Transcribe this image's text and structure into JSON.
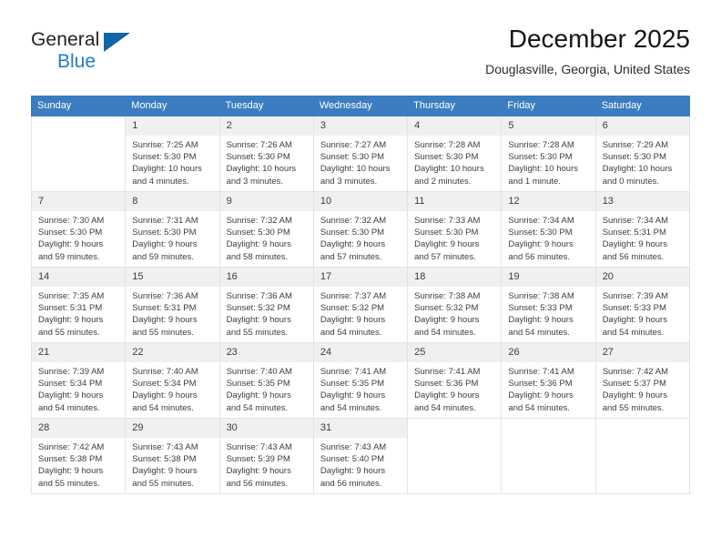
{
  "brand": {
    "name_part1": "General",
    "name_part2": "Blue",
    "triangle_icon": "triangle-logo-icon",
    "accent_color": "#1165ab",
    "blue_text_color": "#1e7bc4"
  },
  "header": {
    "title": "December 2025",
    "subtitle": "Douglasville, Georgia, United States"
  },
  "calendar": {
    "header_background": "#3b7dc0",
    "daynum_background": "#f0f0f0",
    "weekdays": [
      "Sunday",
      "Monday",
      "Tuesday",
      "Wednesday",
      "Thursday",
      "Friday",
      "Saturday"
    ],
    "labels": {
      "sunrise": "Sunrise:",
      "sunset": "Sunset:",
      "daylight": "Daylight:"
    },
    "weeks": [
      [
        {
          "day": "",
          "sunrise": "",
          "sunset": "",
          "daylight_line1": "",
          "daylight_line2": ""
        },
        {
          "day": "1",
          "sunrise": "Sunrise: 7:25 AM",
          "sunset": "Sunset: 5:30 PM",
          "daylight_line1": "Daylight: 10 hours",
          "daylight_line2": "and 4 minutes."
        },
        {
          "day": "2",
          "sunrise": "Sunrise: 7:26 AM",
          "sunset": "Sunset: 5:30 PM",
          "daylight_line1": "Daylight: 10 hours",
          "daylight_line2": "and 3 minutes."
        },
        {
          "day": "3",
          "sunrise": "Sunrise: 7:27 AM",
          "sunset": "Sunset: 5:30 PM",
          "daylight_line1": "Daylight: 10 hours",
          "daylight_line2": "and 3 minutes."
        },
        {
          "day": "4",
          "sunrise": "Sunrise: 7:28 AM",
          "sunset": "Sunset: 5:30 PM",
          "daylight_line1": "Daylight: 10 hours",
          "daylight_line2": "and 2 minutes."
        },
        {
          "day": "5",
          "sunrise": "Sunrise: 7:28 AM",
          "sunset": "Sunset: 5:30 PM",
          "daylight_line1": "Daylight: 10 hours",
          "daylight_line2": "and 1 minute."
        },
        {
          "day": "6",
          "sunrise": "Sunrise: 7:29 AM",
          "sunset": "Sunset: 5:30 PM",
          "daylight_line1": "Daylight: 10 hours",
          "daylight_line2": "and 0 minutes."
        }
      ],
      [
        {
          "day": "7",
          "sunrise": "Sunrise: 7:30 AM",
          "sunset": "Sunset: 5:30 PM",
          "daylight_line1": "Daylight: 9 hours",
          "daylight_line2": "and 59 minutes."
        },
        {
          "day": "8",
          "sunrise": "Sunrise: 7:31 AM",
          "sunset": "Sunset: 5:30 PM",
          "daylight_line1": "Daylight: 9 hours",
          "daylight_line2": "and 59 minutes."
        },
        {
          "day": "9",
          "sunrise": "Sunrise: 7:32 AM",
          "sunset": "Sunset: 5:30 PM",
          "daylight_line1": "Daylight: 9 hours",
          "daylight_line2": "and 58 minutes."
        },
        {
          "day": "10",
          "sunrise": "Sunrise: 7:32 AM",
          "sunset": "Sunset: 5:30 PM",
          "daylight_line1": "Daylight: 9 hours",
          "daylight_line2": "and 57 minutes."
        },
        {
          "day": "11",
          "sunrise": "Sunrise: 7:33 AM",
          "sunset": "Sunset: 5:30 PM",
          "daylight_line1": "Daylight: 9 hours",
          "daylight_line2": "and 57 minutes."
        },
        {
          "day": "12",
          "sunrise": "Sunrise: 7:34 AM",
          "sunset": "Sunset: 5:30 PM",
          "daylight_line1": "Daylight: 9 hours",
          "daylight_line2": "and 56 minutes."
        },
        {
          "day": "13",
          "sunrise": "Sunrise: 7:34 AM",
          "sunset": "Sunset: 5:31 PM",
          "daylight_line1": "Daylight: 9 hours",
          "daylight_line2": "and 56 minutes."
        }
      ],
      [
        {
          "day": "14",
          "sunrise": "Sunrise: 7:35 AM",
          "sunset": "Sunset: 5:31 PM",
          "daylight_line1": "Daylight: 9 hours",
          "daylight_line2": "and 55 minutes."
        },
        {
          "day": "15",
          "sunrise": "Sunrise: 7:36 AM",
          "sunset": "Sunset: 5:31 PM",
          "daylight_line1": "Daylight: 9 hours",
          "daylight_line2": "and 55 minutes."
        },
        {
          "day": "16",
          "sunrise": "Sunrise: 7:36 AM",
          "sunset": "Sunset: 5:32 PM",
          "daylight_line1": "Daylight: 9 hours",
          "daylight_line2": "and 55 minutes."
        },
        {
          "day": "17",
          "sunrise": "Sunrise: 7:37 AM",
          "sunset": "Sunset: 5:32 PM",
          "daylight_line1": "Daylight: 9 hours",
          "daylight_line2": "and 54 minutes."
        },
        {
          "day": "18",
          "sunrise": "Sunrise: 7:38 AM",
          "sunset": "Sunset: 5:32 PM",
          "daylight_line1": "Daylight: 9 hours",
          "daylight_line2": "and 54 minutes."
        },
        {
          "day": "19",
          "sunrise": "Sunrise: 7:38 AM",
          "sunset": "Sunset: 5:33 PM",
          "daylight_line1": "Daylight: 9 hours",
          "daylight_line2": "and 54 minutes."
        },
        {
          "day": "20",
          "sunrise": "Sunrise: 7:39 AM",
          "sunset": "Sunset: 5:33 PM",
          "daylight_line1": "Daylight: 9 hours",
          "daylight_line2": "and 54 minutes."
        }
      ],
      [
        {
          "day": "21",
          "sunrise": "Sunrise: 7:39 AM",
          "sunset": "Sunset: 5:34 PM",
          "daylight_line1": "Daylight: 9 hours",
          "daylight_line2": "and 54 minutes."
        },
        {
          "day": "22",
          "sunrise": "Sunrise: 7:40 AM",
          "sunset": "Sunset: 5:34 PM",
          "daylight_line1": "Daylight: 9 hours",
          "daylight_line2": "and 54 minutes."
        },
        {
          "day": "23",
          "sunrise": "Sunrise: 7:40 AM",
          "sunset": "Sunset: 5:35 PM",
          "daylight_line1": "Daylight: 9 hours",
          "daylight_line2": "and 54 minutes."
        },
        {
          "day": "24",
          "sunrise": "Sunrise: 7:41 AM",
          "sunset": "Sunset: 5:35 PM",
          "daylight_line1": "Daylight: 9 hours",
          "daylight_line2": "and 54 minutes."
        },
        {
          "day": "25",
          "sunrise": "Sunrise: 7:41 AM",
          "sunset": "Sunset: 5:36 PM",
          "daylight_line1": "Daylight: 9 hours",
          "daylight_line2": "and 54 minutes."
        },
        {
          "day": "26",
          "sunrise": "Sunrise: 7:41 AM",
          "sunset": "Sunset: 5:36 PM",
          "daylight_line1": "Daylight: 9 hours",
          "daylight_line2": "and 54 minutes."
        },
        {
          "day": "27",
          "sunrise": "Sunrise: 7:42 AM",
          "sunset": "Sunset: 5:37 PM",
          "daylight_line1": "Daylight: 9 hours",
          "daylight_line2": "and 55 minutes."
        }
      ],
      [
        {
          "day": "28",
          "sunrise": "Sunrise: 7:42 AM",
          "sunset": "Sunset: 5:38 PM",
          "daylight_line1": "Daylight: 9 hours",
          "daylight_line2": "and 55 minutes."
        },
        {
          "day": "29",
          "sunrise": "Sunrise: 7:43 AM",
          "sunset": "Sunset: 5:38 PM",
          "daylight_line1": "Daylight: 9 hours",
          "daylight_line2": "and 55 minutes."
        },
        {
          "day": "30",
          "sunrise": "Sunrise: 7:43 AM",
          "sunset": "Sunset: 5:39 PM",
          "daylight_line1": "Daylight: 9 hours",
          "daylight_line2": "and 56 minutes."
        },
        {
          "day": "31",
          "sunrise": "Sunrise: 7:43 AM",
          "sunset": "Sunset: 5:40 PM",
          "daylight_line1": "Daylight: 9 hours",
          "daylight_line2": "and 56 minutes."
        },
        {
          "day": "",
          "sunrise": "",
          "sunset": "",
          "daylight_line1": "",
          "daylight_line2": ""
        },
        {
          "day": "",
          "sunrise": "",
          "sunset": "",
          "daylight_line1": "",
          "daylight_line2": ""
        },
        {
          "day": "",
          "sunrise": "",
          "sunset": "",
          "daylight_line1": "",
          "daylight_line2": ""
        }
      ]
    ]
  }
}
